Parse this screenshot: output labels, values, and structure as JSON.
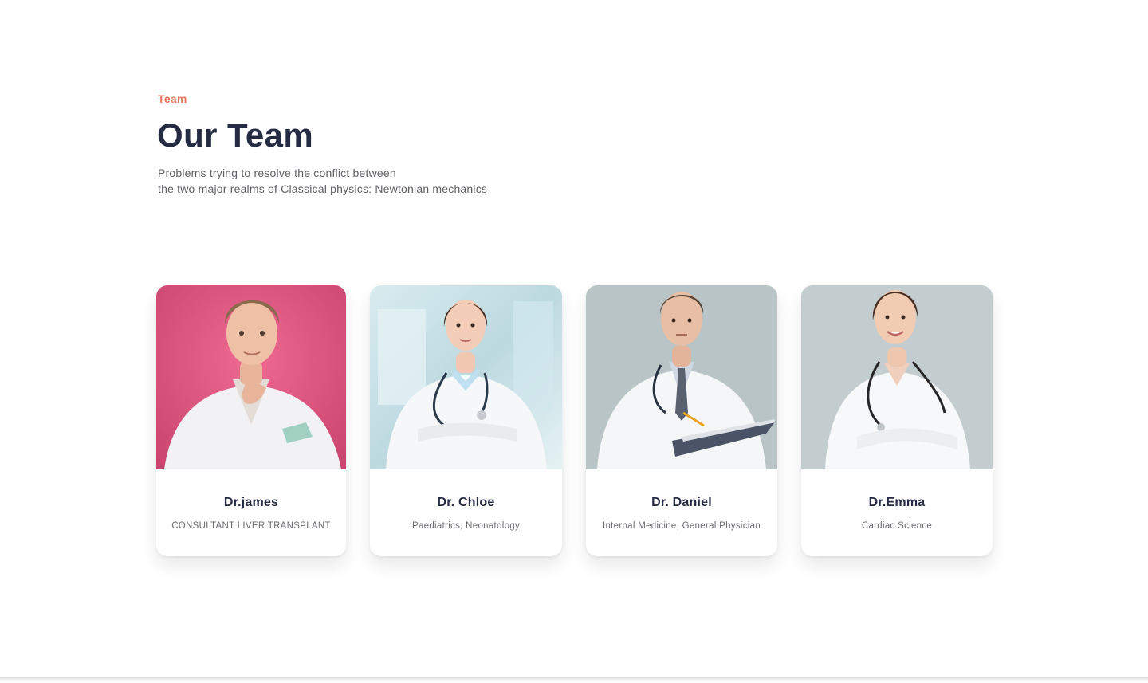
{
  "header": {
    "eyebrow": "Team",
    "title": "Our Team",
    "lead_line1": "Problems trying to resolve the conflict between",
    "lead_line2": "the two major realms of Classical physics: Newtonian mechanics",
    "accent_color": "#e8735c",
    "title_color": "#252b42"
  },
  "team": [
    {
      "name": "Dr.james",
      "role": "CONSULTANT LIVER TRANSPLANT",
      "photo_bg": "#e25a82"
    },
    {
      "name": "Dr. Chloe",
      "role": "Paediatrics, Neonatology",
      "photo_bg": "#cde4ea"
    },
    {
      "name": "Dr. Daniel",
      "role": "Internal Medicine, General Physician",
      "photo_bg": "#b8c4c6"
    },
    {
      "name": "Dr.Emma",
      "role": "Cardiac Science",
      "photo_bg": "#c3cdd0"
    }
  ]
}
